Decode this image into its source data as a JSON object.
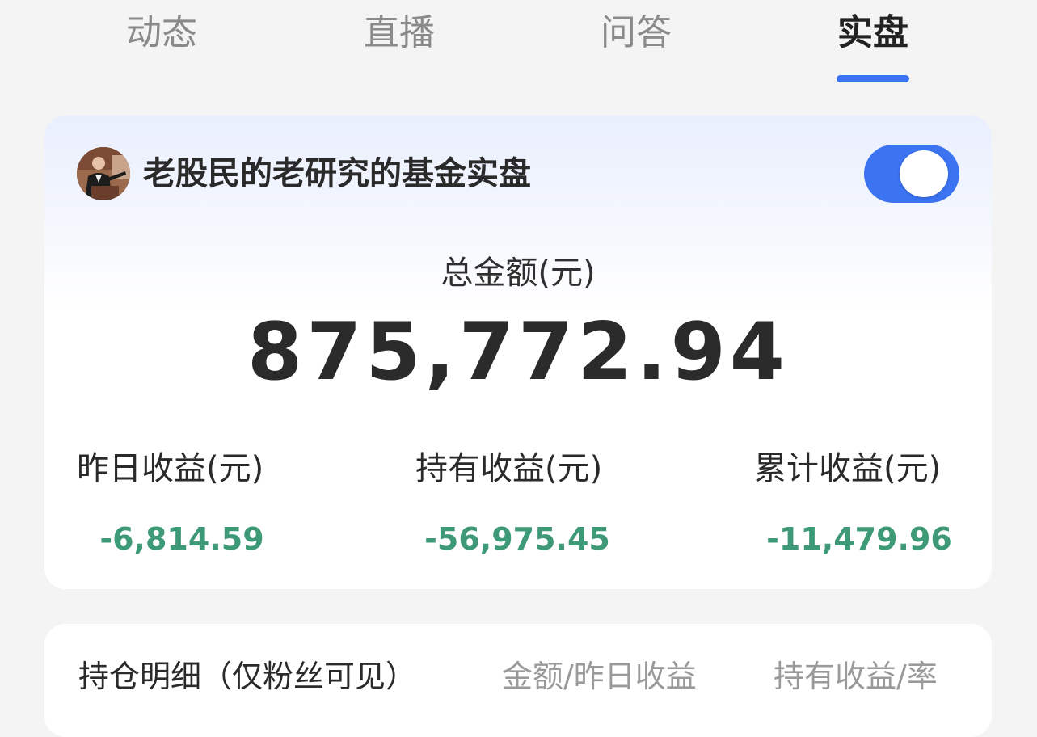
{
  "tabs": [
    {
      "label": "动态",
      "active": false
    },
    {
      "label": "直播",
      "active": false
    },
    {
      "label": "问答",
      "active": false
    },
    {
      "label": "实盘",
      "active": true
    }
  ],
  "portfolio": {
    "title": "老股民的老研究的基金实盘",
    "toggle_on": true,
    "total_label": "总金额(元)",
    "total_value": "875,772.94",
    "stats": [
      {
        "label": "昨日收益(元)",
        "value": "-6,814.59"
      },
      {
        "label": "持有收益(元)",
        "value": "-56,975.45"
      },
      {
        "label": "累计收益(元)",
        "value": "-11,479.96"
      }
    ]
  },
  "holdings": {
    "title": "持仓明细（仅粉丝可见）",
    "col_amount": "金额/昨日收益",
    "col_profit": "持有收益/率"
  },
  "colors": {
    "accent": "#3b73f0",
    "loss_green": "#3e9a76",
    "background": "#f4f4f4"
  }
}
